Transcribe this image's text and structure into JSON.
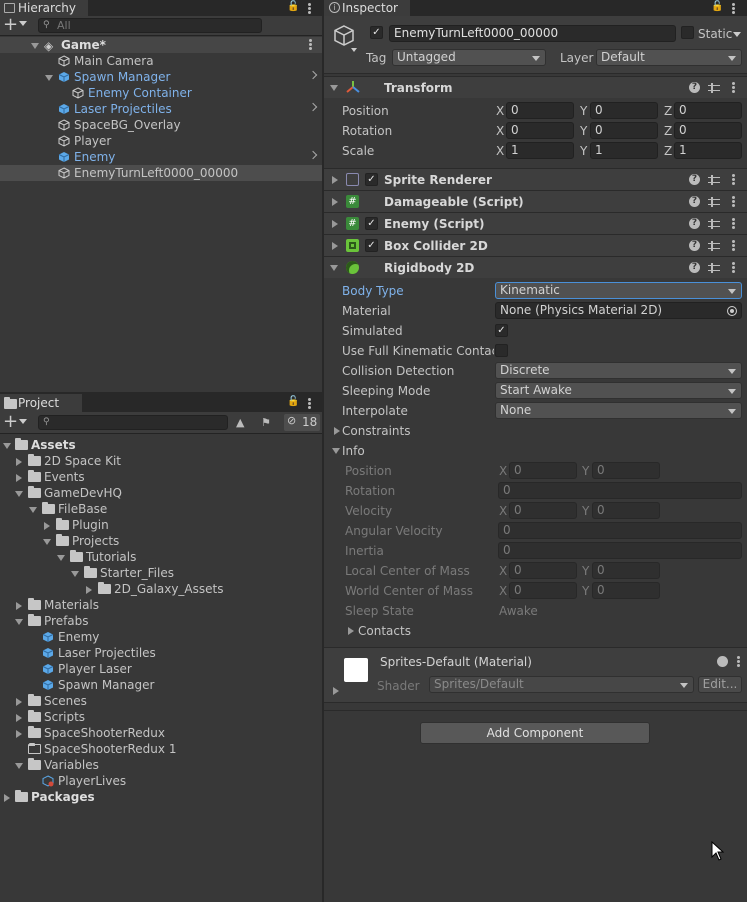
{
  "hierarchy": {
    "tab_label": "Hierarchy",
    "search_placeholder": "All",
    "scene": "Game*",
    "items": [
      {
        "label": "Main Camera",
        "blue": false
      },
      {
        "label": "Spawn Manager",
        "blue": true
      },
      {
        "label": "Enemy Container",
        "blue": true
      },
      {
        "label": "Laser Projectiles",
        "blue": true
      },
      {
        "label": "SpaceBG_Overlay",
        "blue": false
      },
      {
        "label": "Player",
        "blue": false
      },
      {
        "label": "Enemy",
        "blue": true
      },
      {
        "label": "EnemyTurnLeft0000_00000",
        "blue": false
      }
    ]
  },
  "project": {
    "tab_label": "Project",
    "hidden_count": "18",
    "tree": [
      "Assets",
      "2D Space Kit",
      "Events",
      "GameDevHQ",
      "FileBase",
      "Plugin",
      "Projects",
      "Tutorials",
      "Starter_Files",
      "2D_Galaxy_Assets",
      "Materials",
      "Prefabs",
      "Enemy",
      "Laser Projectiles",
      "Player Laser",
      "Spawn Manager",
      "Scenes",
      "Scripts",
      "SpaceShooterRedux",
      "SpaceShooterRedux 1",
      "Variables",
      "PlayerLives",
      "Packages"
    ]
  },
  "inspector": {
    "tab_label": "Inspector",
    "object_name": "EnemyTurnLeft0000_00000",
    "static_label": "Static",
    "tag_label": "Tag",
    "tag_value": "Untagged",
    "layer_label": "Layer",
    "layer_value": "Default",
    "transform": {
      "title": "Transform",
      "rows": [
        {
          "label": "Position",
          "x": "0",
          "y": "0",
          "z": "0"
        },
        {
          "label": "Rotation",
          "x": "0",
          "y": "0",
          "z": "0"
        },
        {
          "label": "Scale",
          "x": "1",
          "y": "1",
          "z": "1"
        }
      ]
    },
    "components": [
      "Sprite Renderer",
      "Damageable (Script)",
      "Enemy (Script)",
      "Box Collider 2D",
      "Rigidbody 2D"
    ],
    "axes": {
      "x": "X",
      "y": "Y",
      "z": "Z"
    },
    "rigidbody": {
      "body_type_label": "Body Type",
      "body_type_value": "Kinematic",
      "material_label": "Material",
      "material_value": "None (Physics Material 2D)",
      "simulated_label": "Simulated",
      "full_kinematic_label": "Use Full Kinematic Contact",
      "collision_label": "Collision Detection",
      "collision_value": "Discrete",
      "sleeping_label": "Sleeping Mode",
      "sleeping_value": "Start Awake",
      "interpolate_label": "Interpolate",
      "interpolate_value": "None",
      "constraints_label": "Constraints",
      "info_label": "Info",
      "info": {
        "position_label": "Position",
        "position_x": "0",
        "position_y": "0",
        "rotation_label": "Rotation",
        "rotation": "0",
        "velocity_label": "Velocity",
        "velocity_x": "0",
        "velocity_y": "0",
        "angular_label": "Angular Velocity",
        "angular": "0",
        "inertia_label": "Inertia",
        "inertia": "0",
        "local_com_label": "Local Center of Mass",
        "local_x": "0",
        "local_y": "0",
        "world_com_label": "World Center of Mass",
        "world_x": "0",
        "world_y": "0",
        "sleep_state_label": "Sleep State",
        "sleep_state": "Awake",
        "contacts_label": "Contacts"
      }
    },
    "material_block": {
      "title": "Sprites-Default (Material)",
      "shader_label": "Shader",
      "shader_value": "Sprites/Default",
      "edit_label": "Edit..."
    },
    "add_component_label": "Add Component"
  }
}
